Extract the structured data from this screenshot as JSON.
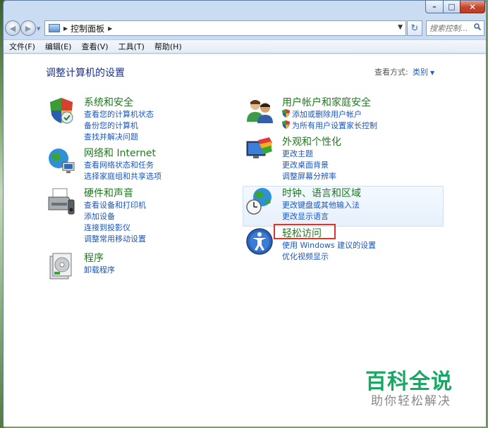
{
  "window": {
    "caption_buttons": [
      "minimize",
      "maximize",
      "close"
    ],
    "colors": {
      "frame": "#c9dcf1",
      "close": "#c2462e"
    }
  },
  "navigation": {
    "breadcrumb": "控制面板",
    "search_placeholder": "搜索控制..."
  },
  "menu": {
    "items": [
      "文件(F)",
      "编辑(E)",
      "查看(V)",
      "工具(T)",
      "帮助(H)"
    ]
  },
  "main": {
    "heading": "调整计算机的设置",
    "view_by_label": "查看方式:",
    "view_by_value": "类别",
    "categories": [
      {
        "title": "系统和安全",
        "icon": "shield-icon",
        "links": [
          "查看您的计算机状态",
          "备份您的计算机",
          "查找并解决问题"
        ]
      },
      {
        "title": "网络和 Internet",
        "icon": "network-globe-icon",
        "links": [
          "查看网络状态和任务",
          "选择家庭组和共享选项"
        ]
      },
      {
        "title": "硬件和声音",
        "icon": "printer-icon",
        "links": [
          "查看设备和打印机",
          "添加设备",
          "连接到投影仪",
          "调整常用移动设置"
        ]
      },
      {
        "title": "程序",
        "icon": "programs-icon",
        "links": [
          "卸载程序"
        ]
      },
      {
        "title": "用户帐户和家庭安全",
        "icon": "users-icon",
        "links": [
          "添加或删除用户帐户",
          "为所有用户设置家长控制"
        ]
      },
      {
        "title": "外观和个性化",
        "icon": "personalization-icon",
        "links": [
          "更改主题",
          "更改桌面背景",
          "调整屏幕分辨率"
        ]
      },
      {
        "title": "时钟、语言和区域",
        "icon": "clock-globe-icon",
        "links": [
          "更改键盘或其他输入法",
          "更改显示语言"
        ]
      },
      {
        "title": "轻松访问",
        "icon": "ease-of-access-icon",
        "links": [
          "使用 Windows 建议的设置",
          "优化视频显示"
        ]
      }
    ]
  },
  "watermark": {
    "title": "百科全说",
    "subtitle": "助你轻松解决",
    "color": "#19a863"
  }
}
